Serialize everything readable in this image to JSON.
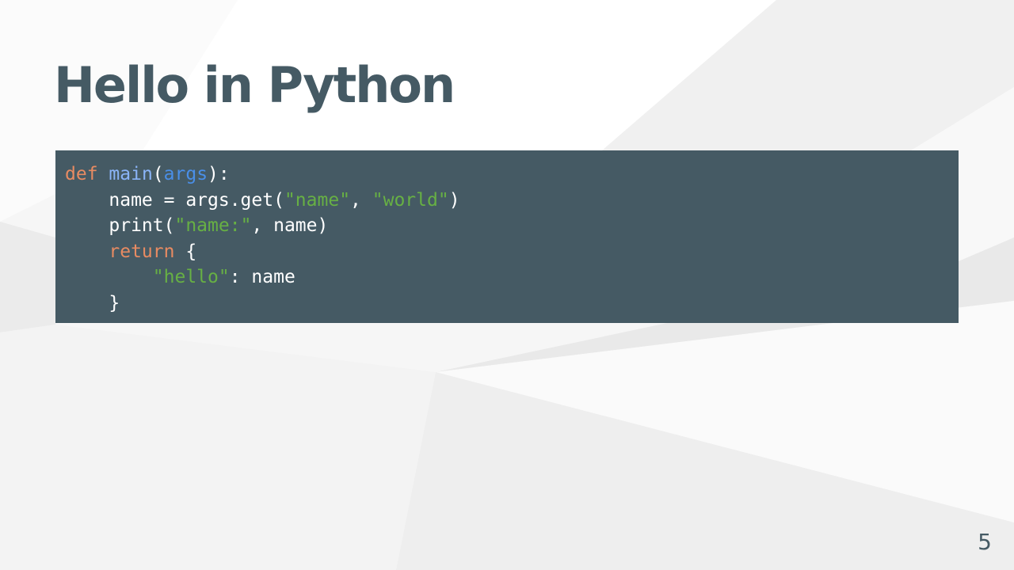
{
  "slide": {
    "title": "Hello in Python",
    "page_number": "5"
  },
  "code": {
    "lines": [
      [
        {
          "t": "def",
          "c": "kw"
        },
        {
          "t": " "
        },
        {
          "t": "main",
          "c": "fn"
        },
        {
          "t": "("
        },
        {
          "t": "args",
          "c": "arg"
        },
        {
          "t": "):"
        }
      ],
      [
        {
          "t": "    name = args.get("
        },
        {
          "t": "\"name\"",
          "c": "str"
        },
        {
          "t": ", "
        },
        {
          "t": "\"world\"",
          "c": "str"
        },
        {
          "t": ")"
        }
      ],
      [
        {
          "t": "    print("
        },
        {
          "t": "\"name:\"",
          "c": "str"
        },
        {
          "t": ", name)"
        }
      ],
      [
        {
          "t": "    "
        },
        {
          "t": "return",
          "c": "kw"
        },
        {
          "t": " {"
        }
      ],
      [
        {
          "t": "        "
        },
        {
          "t": "\"hello\"",
          "c": "str"
        },
        {
          "t": ": name"
        }
      ],
      [
        {
          "t": "    }"
        }
      ]
    ]
  },
  "colors": {
    "title": "#455a64",
    "code_background": "#455a64",
    "keyword": "#e88b62",
    "function": "#8ab4f8",
    "argument": "#4a8fe8",
    "string": "#67b044",
    "plain": "#ffffff"
  }
}
